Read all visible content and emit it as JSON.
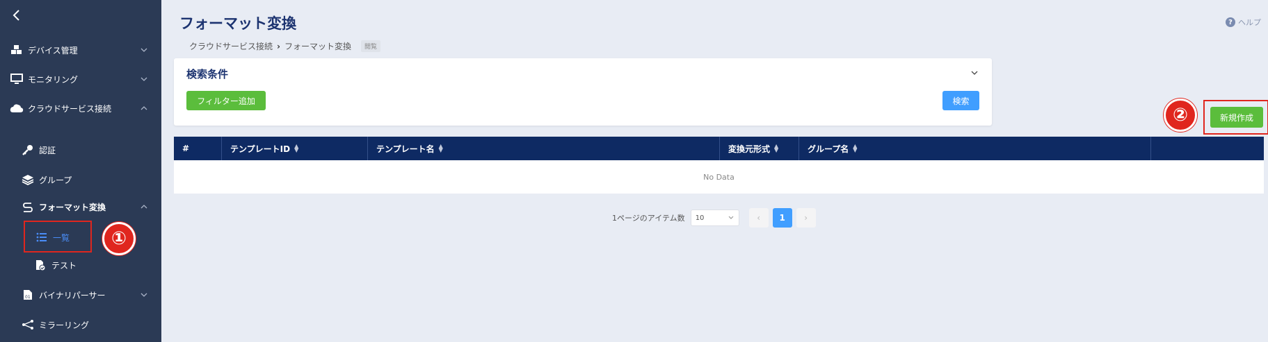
{
  "sidebar": {
    "items": [
      {
        "label": "デバイス管理"
      },
      {
        "label": "モニタリング"
      },
      {
        "label": "クラウドサービス接続"
      },
      {
        "label": "認証"
      },
      {
        "label": "グループ"
      },
      {
        "label": "フォーマット変換"
      },
      {
        "label": "一覧"
      },
      {
        "label": "テスト"
      },
      {
        "label": "バイナリパーサー"
      },
      {
        "label": "ミラーリング"
      }
    ]
  },
  "header": {
    "title": "フォーマット変換",
    "help": "ヘルプ",
    "breadcrumb": [
      "クラウドサービス接続",
      "フォーマット変換"
    ],
    "badge": "閲覧"
  },
  "search": {
    "title": "検索条件",
    "filter_button": "フィルター追加",
    "search_button": "検索"
  },
  "actions": {
    "new_button": "新規作成"
  },
  "callouts": [
    "①",
    "②"
  ],
  "table": {
    "columns": [
      "#",
      "テンプレートID",
      "テンプレート名",
      "変換元形式",
      "グループ名",
      ""
    ],
    "empty": "No Data"
  },
  "pagination": {
    "per_page_label": "1ページのアイテム数",
    "per_page_value": "10",
    "current_page": "1",
    "prev": "‹",
    "next": "›"
  },
  "colors": {
    "sidebar": "#2b3a55",
    "primary": "#409eff",
    "success": "#5bbd3c",
    "table_header": "#0e2a63",
    "highlight": "#e0261e"
  }
}
